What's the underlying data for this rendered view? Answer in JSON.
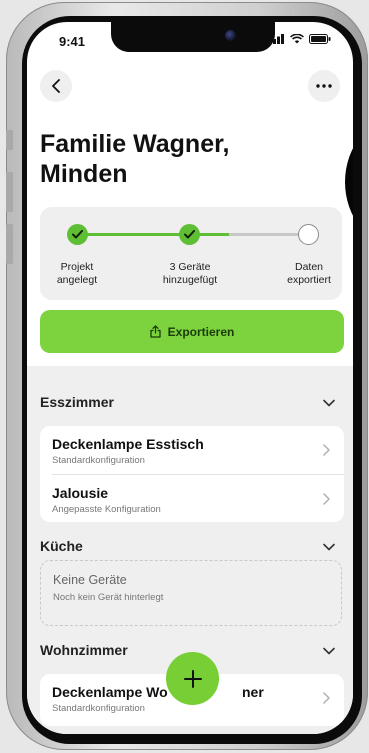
{
  "status_bar": {
    "time": "9:41"
  },
  "nav": {
    "back_icon": "chevron-left-icon",
    "more_icon": "ellipsis-icon"
  },
  "page": {
    "title_line1": "Familie Wagner,",
    "title_line2": "Minden"
  },
  "progress": {
    "steps": [
      {
        "label_line1": "Projekt",
        "label_line2": "angelegt",
        "done": true
      },
      {
        "label_line1": "3 Geräte",
        "label_line2": "hinzugefügt",
        "done": true
      },
      {
        "label_line1": "Daten",
        "label_line2": "exportiert",
        "done": false
      }
    ]
  },
  "export_button": {
    "label": "Exportieren",
    "icon": "share-icon"
  },
  "rooms": [
    {
      "name": "Esszimmer",
      "devices": [
        {
          "name": "Deckenlampe Esstisch",
          "config": "Standardkonfiguration"
        },
        {
          "name": "Jalousie",
          "config": "Angepasste Konfiguration"
        }
      ]
    },
    {
      "name": "Küche",
      "empty_title": "Keine Geräte",
      "empty_subtitle": "Noch kein Gerät hinterlegt"
    },
    {
      "name": "Wohnzimmer",
      "devices": [
        {
          "name_left": "Deckenlampe Wo",
          "name_right": "ner",
          "config": "Standardkonfiguration"
        }
      ]
    }
  ],
  "fab": {
    "icon": "plus-icon"
  },
  "colors": {
    "accent": "#7cd33e",
    "accent_dark": "#5fbf34",
    "background": "#efefef"
  }
}
